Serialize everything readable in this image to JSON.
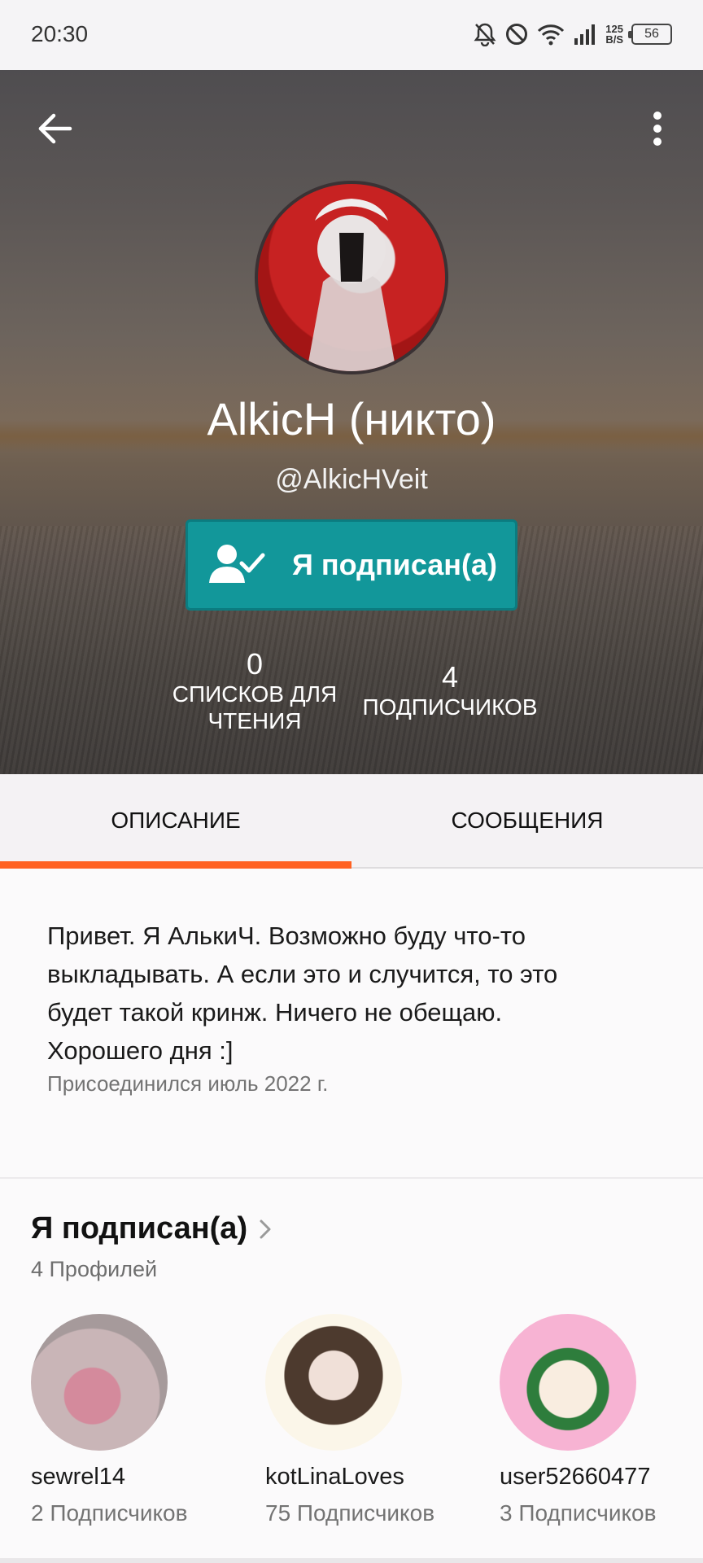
{
  "status_bar": {
    "time": "20:30",
    "net_speed_value": "125",
    "net_speed_unit": "B/S",
    "battery": "56",
    "icons": [
      "bell-off-icon",
      "do-not-disturb-icon",
      "wifi-icon",
      "signal-icon",
      "battery-icon"
    ]
  },
  "header": {
    "back_icon": "arrow-left-icon",
    "menu_icon": "more-vertical-icon",
    "display_name": "AlkicH (никто)",
    "username": "@AlkicHVeit",
    "follow_button_label": "Я подписан(а)",
    "follow_button_icon": "user-check-icon",
    "follow_button_color": "#12979a",
    "stats": {
      "reading_lists_count": "0",
      "reading_lists_label_line1": "СПИСКОВ ДЛЯ",
      "reading_lists_label_line2": "ЧТЕНИЯ",
      "followers_count": "4",
      "followers_label": "ПОДПИСЧИКОВ"
    }
  },
  "tabs": [
    {
      "label": "ОПИСАНИЕ",
      "active": true
    },
    {
      "label": "СООБЩЕНИЯ",
      "active": false
    }
  ],
  "accent_color": "#ff6122",
  "about": {
    "description": "Привет. Я АлькиЧ. Возможно буду что-то выкладывать. А если это и случится, то это будет такой кринж. Ничего не обещаю. Хорошего дня :]",
    "joined": "Присоединился июль 2022 г."
  },
  "following": {
    "title": "Я подписан(а)",
    "count_label": "4 Профилей",
    "profiles": [
      {
        "name": "sewrel14",
        "followers": "2 Подписчиков"
      },
      {
        "name": "kotLinaLoves",
        "followers": "75 Подписчиков"
      },
      {
        "name": "user52660477",
        "followers": "3 Подписчиков"
      }
    ]
  }
}
